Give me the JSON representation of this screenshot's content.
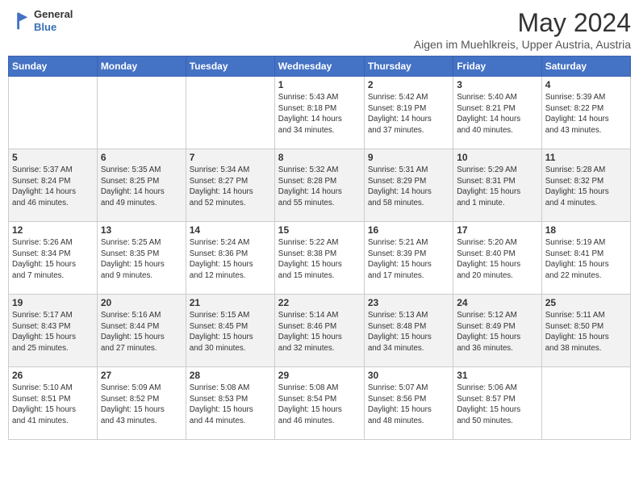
{
  "header": {
    "logo_general": "General",
    "logo_blue": "Blue",
    "month_year": "May 2024",
    "location": "Aigen im Muehlkreis, Upper Austria, Austria"
  },
  "days_of_week": [
    "Sunday",
    "Monday",
    "Tuesday",
    "Wednesday",
    "Thursday",
    "Friday",
    "Saturday"
  ],
  "weeks": [
    [
      {
        "day": "",
        "info": ""
      },
      {
        "day": "",
        "info": ""
      },
      {
        "day": "",
        "info": ""
      },
      {
        "day": "1",
        "info": "Sunrise: 5:43 AM\nSunset: 8:18 PM\nDaylight: 14 hours\nand 34 minutes."
      },
      {
        "day": "2",
        "info": "Sunrise: 5:42 AM\nSunset: 8:19 PM\nDaylight: 14 hours\nand 37 minutes."
      },
      {
        "day": "3",
        "info": "Sunrise: 5:40 AM\nSunset: 8:21 PM\nDaylight: 14 hours\nand 40 minutes."
      },
      {
        "day": "4",
        "info": "Sunrise: 5:39 AM\nSunset: 8:22 PM\nDaylight: 14 hours\nand 43 minutes."
      }
    ],
    [
      {
        "day": "5",
        "info": "Sunrise: 5:37 AM\nSunset: 8:24 PM\nDaylight: 14 hours\nand 46 minutes."
      },
      {
        "day": "6",
        "info": "Sunrise: 5:35 AM\nSunset: 8:25 PM\nDaylight: 14 hours\nand 49 minutes."
      },
      {
        "day": "7",
        "info": "Sunrise: 5:34 AM\nSunset: 8:27 PM\nDaylight: 14 hours\nand 52 minutes."
      },
      {
        "day": "8",
        "info": "Sunrise: 5:32 AM\nSunset: 8:28 PM\nDaylight: 14 hours\nand 55 minutes."
      },
      {
        "day": "9",
        "info": "Sunrise: 5:31 AM\nSunset: 8:29 PM\nDaylight: 14 hours\nand 58 minutes."
      },
      {
        "day": "10",
        "info": "Sunrise: 5:29 AM\nSunset: 8:31 PM\nDaylight: 15 hours\nand 1 minute."
      },
      {
        "day": "11",
        "info": "Sunrise: 5:28 AM\nSunset: 8:32 PM\nDaylight: 15 hours\nand 4 minutes."
      }
    ],
    [
      {
        "day": "12",
        "info": "Sunrise: 5:26 AM\nSunset: 8:34 PM\nDaylight: 15 hours\nand 7 minutes."
      },
      {
        "day": "13",
        "info": "Sunrise: 5:25 AM\nSunset: 8:35 PM\nDaylight: 15 hours\nand 9 minutes."
      },
      {
        "day": "14",
        "info": "Sunrise: 5:24 AM\nSunset: 8:36 PM\nDaylight: 15 hours\nand 12 minutes."
      },
      {
        "day": "15",
        "info": "Sunrise: 5:22 AM\nSunset: 8:38 PM\nDaylight: 15 hours\nand 15 minutes."
      },
      {
        "day": "16",
        "info": "Sunrise: 5:21 AM\nSunset: 8:39 PM\nDaylight: 15 hours\nand 17 minutes."
      },
      {
        "day": "17",
        "info": "Sunrise: 5:20 AM\nSunset: 8:40 PM\nDaylight: 15 hours\nand 20 minutes."
      },
      {
        "day": "18",
        "info": "Sunrise: 5:19 AM\nSunset: 8:41 PM\nDaylight: 15 hours\nand 22 minutes."
      }
    ],
    [
      {
        "day": "19",
        "info": "Sunrise: 5:17 AM\nSunset: 8:43 PM\nDaylight: 15 hours\nand 25 minutes."
      },
      {
        "day": "20",
        "info": "Sunrise: 5:16 AM\nSunset: 8:44 PM\nDaylight: 15 hours\nand 27 minutes."
      },
      {
        "day": "21",
        "info": "Sunrise: 5:15 AM\nSunset: 8:45 PM\nDaylight: 15 hours\nand 30 minutes."
      },
      {
        "day": "22",
        "info": "Sunrise: 5:14 AM\nSunset: 8:46 PM\nDaylight: 15 hours\nand 32 minutes."
      },
      {
        "day": "23",
        "info": "Sunrise: 5:13 AM\nSunset: 8:48 PM\nDaylight: 15 hours\nand 34 minutes."
      },
      {
        "day": "24",
        "info": "Sunrise: 5:12 AM\nSunset: 8:49 PM\nDaylight: 15 hours\nand 36 minutes."
      },
      {
        "day": "25",
        "info": "Sunrise: 5:11 AM\nSunset: 8:50 PM\nDaylight: 15 hours\nand 38 minutes."
      }
    ],
    [
      {
        "day": "26",
        "info": "Sunrise: 5:10 AM\nSunset: 8:51 PM\nDaylight: 15 hours\nand 41 minutes."
      },
      {
        "day": "27",
        "info": "Sunrise: 5:09 AM\nSunset: 8:52 PM\nDaylight: 15 hours\nand 43 minutes."
      },
      {
        "day": "28",
        "info": "Sunrise: 5:08 AM\nSunset: 8:53 PM\nDaylight: 15 hours\nand 44 minutes."
      },
      {
        "day": "29",
        "info": "Sunrise: 5:08 AM\nSunset: 8:54 PM\nDaylight: 15 hours\nand 46 minutes."
      },
      {
        "day": "30",
        "info": "Sunrise: 5:07 AM\nSunset: 8:56 PM\nDaylight: 15 hours\nand 48 minutes."
      },
      {
        "day": "31",
        "info": "Sunrise: 5:06 AM\nSunset: 8:57 PM\nDaylight: 15 hours\nand 50 minutes."
      },
      {
        "day": "",
        "info": ""
      }
    ]
  ]
}
